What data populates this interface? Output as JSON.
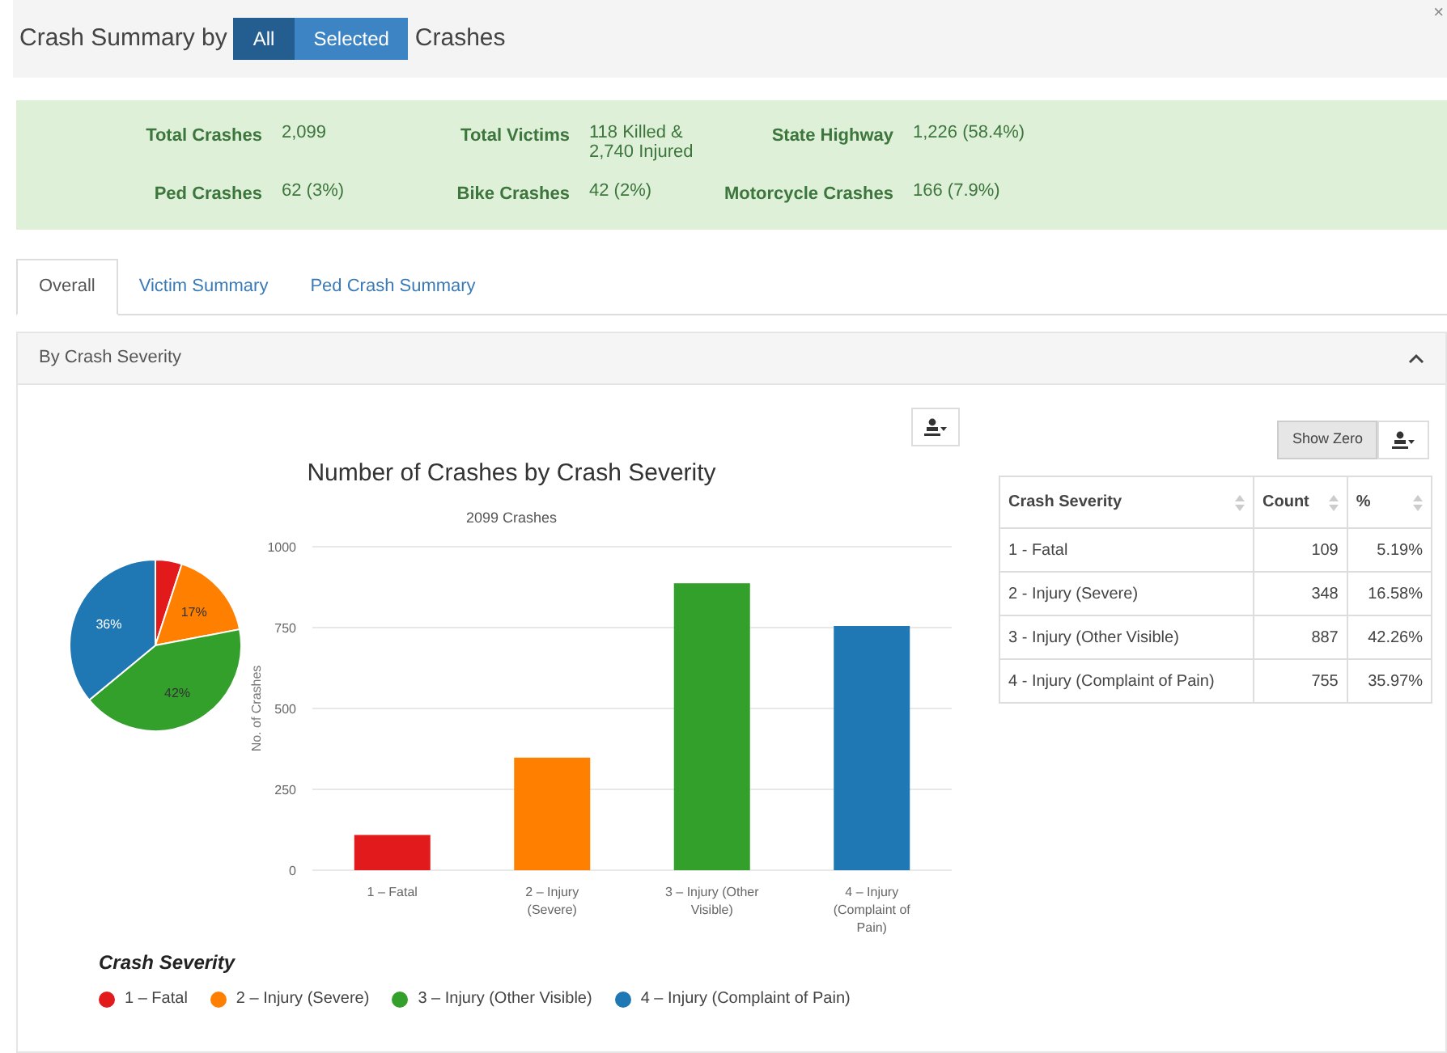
{
  "header": {
    "title_prefix": "Crash Summary by",
    "toggle": [
      {
        "label": "All",
        "selected": true
      },
      {
        "label": "Selected",
        "selected": false
      }
    ],
    "title_suffix": "Crashes",
    "close": "×"
  },
  "summary": [
    {
      "label": "Total Crashes",
      "value": "2,099"
    },
    {
      "label": "Total Victims",
      "value": "118 Killed & 2,740 Injured"
    },
    {
      "label": "State Highway",
      "value": "1,226 (58.4%)"
    },
    {
      "label": "Ped Crashes",
      "value": "62 (3%)"
    },
    {
      "label": "Bike Crashes",
      "value": "42 (2%)"
    },
    {
      "label": "Motorcycle Crashes",
      "value": "166 (7.9%)"
    }
  ],
  "tabs": [
    {
      "label": "Overall",
      "selected": true
    },
    {
      "label": "Victim Summary",
      "selected": false
    },
    {
      "label": "Ped Crash Summary",
      "selected": false
    }
  ],
  "panel": {
    "title": "By Crash Severity",
    "expanded": true
  },
  "pie": {
    "chart_data": {
      "type": "pie",
      "values": [
        5,
        17,
        42,
        36
      ],
      "colors": [
        "#e31a1c",
        "#ff7f00",
        "#33a02c",
        "#1f78b4"
      ],
      "value_labels": [
        null,
        "17%",
        "42%",
        "36%"
      ]
    }
  },
  "bar": {
    "subtitle": "2099 Crashes",
    "chart_data": {
      "type": "bar",
      "title": "Number of Crashes by Crash Severity",
      "ylabel": "No. of Crashes",
      "categories": [
        "1 – Fatal",
        "2 – Injury (Severe)",
        "3 – Injury (Other Visible)",
        "4 – Injury (Complaint of Pain)"
      ],
      "ylim": [
        0,
        1000
      ],
      "yticks": [
        0,
        250,
        500,
        750,
        1000
      ],
      "grid": true,
      "colors": [
        "#e31a1c",
        "#ff7f00",
        "#33a02c",
        "#1f78b4"
      ],
      "values": [
        109,
        348,
        887,
        755
      ]
    }
  },
  "legend": {
    "title": "Crash Severity",
    "items": [
      {
        "label": "1 – Fatal",
        "color": "#e31a1c"
      },
      {
        "label": "2 – Injury (Severe)",
        "color": "#ff7f00"
      },
      {
        "label": "3 – Injury (Other Visible)",
        "color": "#33a02c"
      },
      {
        "label": "4 – Injury (Complaint of Pain)",
        "color": "#1f78b4"
      }
    ]
  },
  "table": {
    "show_zero": "Show Zero",
    "columns": [
      "Crash Severity",
      "Count",
      "%"
    ],
    "rows": [
      [
        "1 - Fatal",
        "109",
        "5.19%"
      ],
      [
        "2 - Injury (Severe)",
        "348",
        "16.58%"
      ],
      [
        "3 - Injury (Other Visible)",
        "887",
        "42.26%"
      ],
      [
        "4 - Injury (Complaint of Pain)",
        "755",
        "35.97%"
      ]
    ]
  }
}
